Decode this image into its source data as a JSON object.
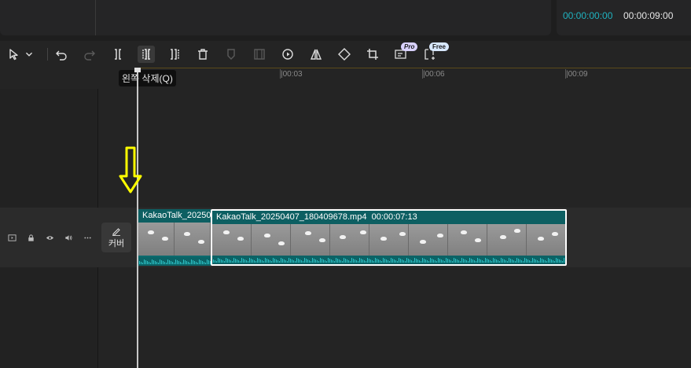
{
  "header": {
    "time_current": "00:00:00:00",
    "time_total": "00:00:09:00"
  },
  "toolbar": {
    "tools": [
      "select-icon",
      "dropdown-chevron-icon",
      "undo-icon",
      "redo-icon",
      "split-icon",
      "delete-left-icon",
      "delete-right-icon",
      "delete-icon",
      "mark-icon",
      "freeze-frame-icon",
      "reverse-icon",
      "mirror-icon",
      "rotate-icon",
      "crop-icon",
      "auto-caption-icon",
      "auto-reframe-icon"
    ],
    "badge_pro": "Pro",
    "badge_free": "Free",
    "tooltip": "왼쪽 삭제(Q)"
  },
  "ruler": {
    "labels": [
      "|00:03",
      "|00:06",
      "|00:09"
    ]
  },
  "track": {
    "controls": [
      "track-video-icon",
      "lock-icon",
      "eye-icon",
      "volume-icon",
      "more-icon"
    ],
    "cover_label": "커버"
  },
  "clips": [
    {
      "name": "KakaoTalk_20250",
      "duration": ""
    },
    {
      "name": "KakaoTalk_20250407_180409678.mp4",
      "duration": "00:00:07:13"
    }
  ],
  "colors": {
    "accent_time": "#1fb3c0",
    "clip_fill": "#0c6b6e",
    "annotation_arrow": "#ffff00"
  }
}
